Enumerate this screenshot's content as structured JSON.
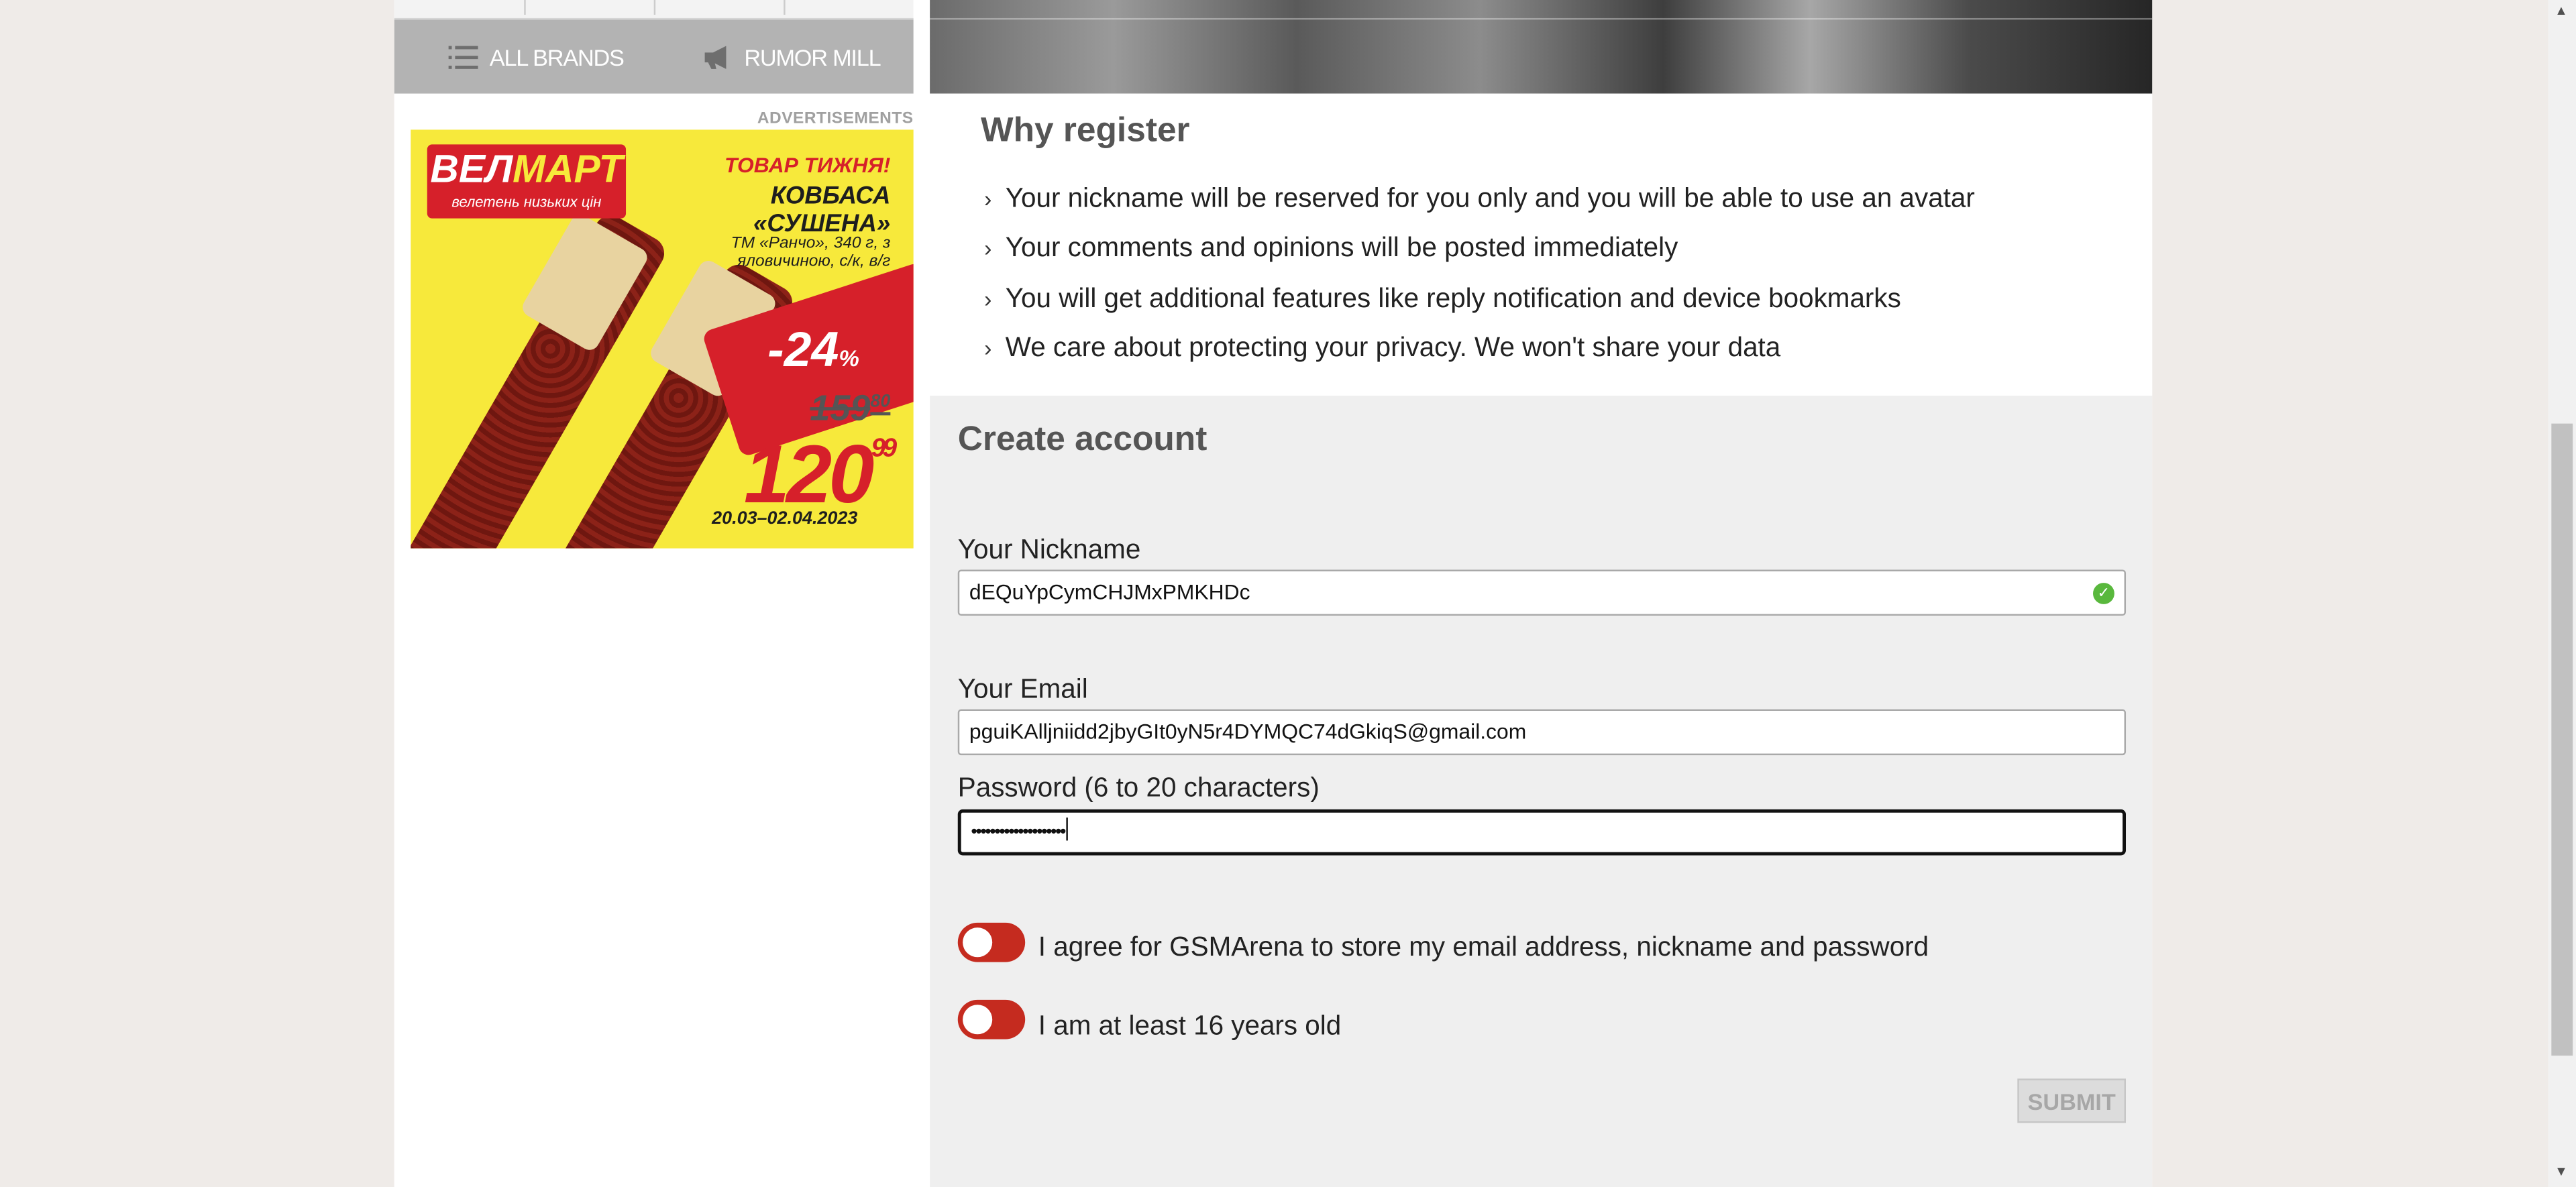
{
  "sidebar": {
    "nav": {
      "all_brands": "ALL BRANDS",
      "rumor_mill": "RUMOR MILL"
    },
    "ads_label": "ADVERTISEMENTS",
    "ad": {
      "logo_main_a": "ВЕЛ",
      "logo_main_b": "МАРТ",
      "logo_sub": "велетень низьких цін",
      "headline": "ТОВАР ТИЖНЯ!",
      "product": "КОВБАСА «СУШЕНА»",
      "details": "ТМ «Ранчо», 340 г, з яловичиною, с/к, в/г",
      "discount": "-24",
      "discount_unit": "%",
      "old_price": "159",
      "old_price_cents": "80",
      "new_price": "120",
      "new_price_cents": "99",
      "dates": "20.03–02.04.2023"
    }
  },
  "why": {
    "title": "Why register",
    "items": [
      "Your nickname will be reserved for you only and you will be able to use an avatar",
      "Your comments and opinions will be posted immediately",
      "You will get additional features like reply notification and device bookmarks",
      "We care about protecting your privacy. We won't share your data"
    ]
  },
  "form": {
    "title": "Create account",
    "nickname_label": "Your Nickname",
    "nickname_value": "dEQuYpCymCHJMxPMKHDc",
    "email_label": "Your Email",
    "email_value": "pguiKAlljniidd2jbyGIt0yN5r4DYMQC74dGkiqS@gmail.com",
    "password_label": "Password (6 to 20 characters)",
    "password_value": "••••••••••••••••••••",
    "agree_label": "I agree for GSMArena to store my email address, nickname and password",
    "age_label": "I am at least 16 years old",
    "submit_label": "SUBMIT"
  },
  "colors": {
    "toggle": "#c52b1f",
    "valid_check": "#59b83d",
    "nav_bar": "#b3b3b3"
  },
  "icons": {
    "all_brands": "list-icon",
    "rumor_mill": "megaphone-icon",
    "nickname_status": "check-circle-icon"
  }
}
